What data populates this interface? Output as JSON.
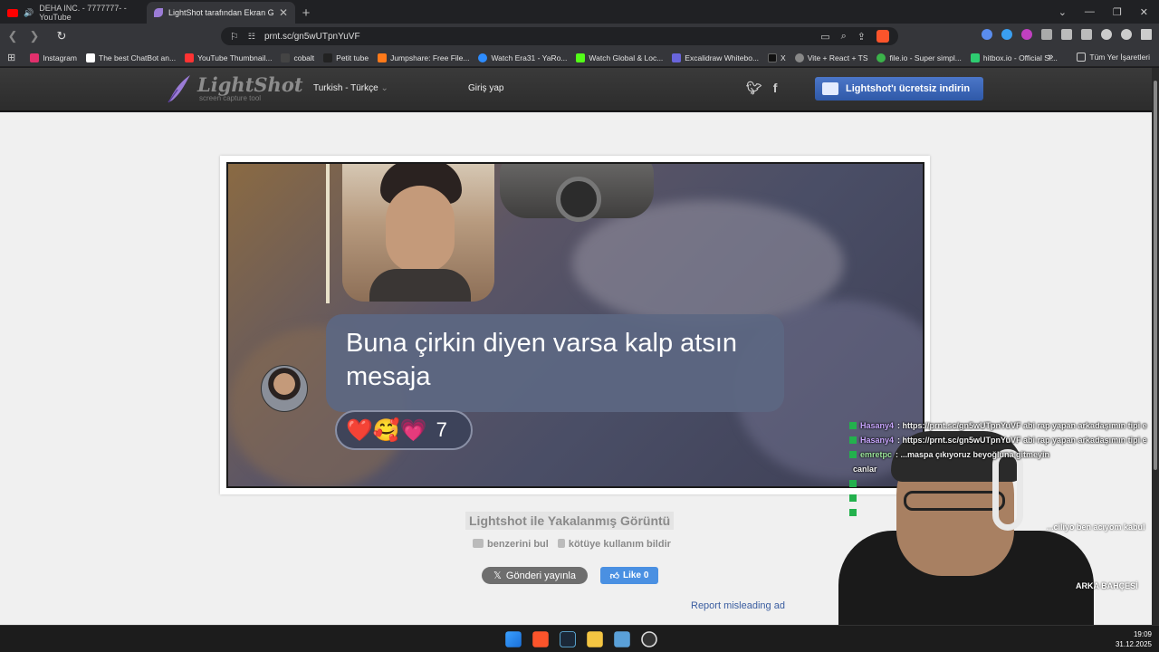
{
  "browser": {
    "tabs": [
      {
        "label": "DEHA INC. - 7777777- - YouTube",
        "favicon_color": "#ff0000"
      },
      {
        "label": "LightShot tarafından Ekran Görü",
        "favicon_color": "#9b7cd6"
      }
    ],
    "url": "prnt.sc/gn5wUTpnYuVF",
    "bookmarks": [
      {
        "label": "Instagram",
        "color": "#e1306c"
      },
      {
        "label": "The best ChatBot an...",
        "color": "#ffffff"
      },
      {
        "label": "YouTube Thumbnail...",
        "color": "#ff0000"
      },
      {
        "label": "cobalt",
        "color": "#444444"
      },
      {
        "label": "Petit tube",
        "color": "#222222"
      },
      {
        "label": "Jumpshare: Free File...",
        "color": "#ff7a1a"
      },
      {
        "label": "Watch Era31 - YaRo...",
        "color": "#2d8cff"
      },
      {
        "label": "Watch Global & Loc...",
        "color": "#53fc18"
      },
      {
        "label": "Excalidraw Whitebo...",
        "color": "#6965db"
      },
      {
        "label": "X",
        "color": "#111111"
      },
      {
        "label": "Vite + React + TS",
        "color": "#888888"
      },
      {
        "label": "file.io - Super simpl...",
        "color": "#3bb34a"
      },
      {
        "label": "hitbox.io - Official Si...",
        "color": "#2ecc71"
      }
    ],
    "bookmarks_more": "»",
    "bookmarks_all": "Tüm Yer İşaretleri"
  },
  "lightshot": {
    "logo_name": "LightShot",
    "logo_sub": "screen capture tool",
    "language": "Turkish - Türkçe",
    "login": "Giriş yap",
    "download_button": "Lightshot'ı ücretsiz indirin"
  },
  "screenshot": {
    "message": "Buna çirkin diyen varsa kalp atsın mesaja",
    "reactions": "❤️🥰💗",
    "reaction_count": "7"
  },
  "page": {
    "caption": "Lightshot ile Yakalanmış Görüntü",
    "similar": "benzerini bul",
    "report_abuse": "kötüye kullanım bildir",
    "tweet": "Gönderi yayınla",
    "like": "Like 0",
    "report_ad": "Report misleading ad"
  },
  "stream_chat": [
    {
      "user": "Hasany4",
      "user_color": "#c9a7ff",
      "msg": ": https://prnt.sc/gn5wUTpnYuVF abi rap yapan arkadaşımın tipi e"
    },
    {
      "user": "Hasany4",
      "user_color": "#c9a7ff",
      "msg": ": https://prnt.sc/gn5wUTpnYuVF abi rap yapan arkadaşımın tipi e"
    },
    {
      "user": "emretpc",
      "user_color": "#9ee89e",
      "msg": ": ...maspa çıkıyoruz beyoğluna gitmeyin"
    },
    {
      "user": "",
      "user_color": "#ffffff",
      "msg": "canlar"
    },
    {
      "user": "",
      "user_color": "#ff5a5a",
      "msg": ""
    },
    {
      "user": "",
      "user_color": "#ff5a5a",
      "msg": ""
    },
    {
      "user": "",
      "user_color": "#ffffff",
      "msg": ""
    }
  ],
  "stream_overlay": {
    "line_right": "...ciliyo ben acıyom kabul",
    "garden": "ARKA BAHÇESİ"
  },
  "taskbar": {
    "time": "19:09",
    "date": "31.12.2025"
  }
}
